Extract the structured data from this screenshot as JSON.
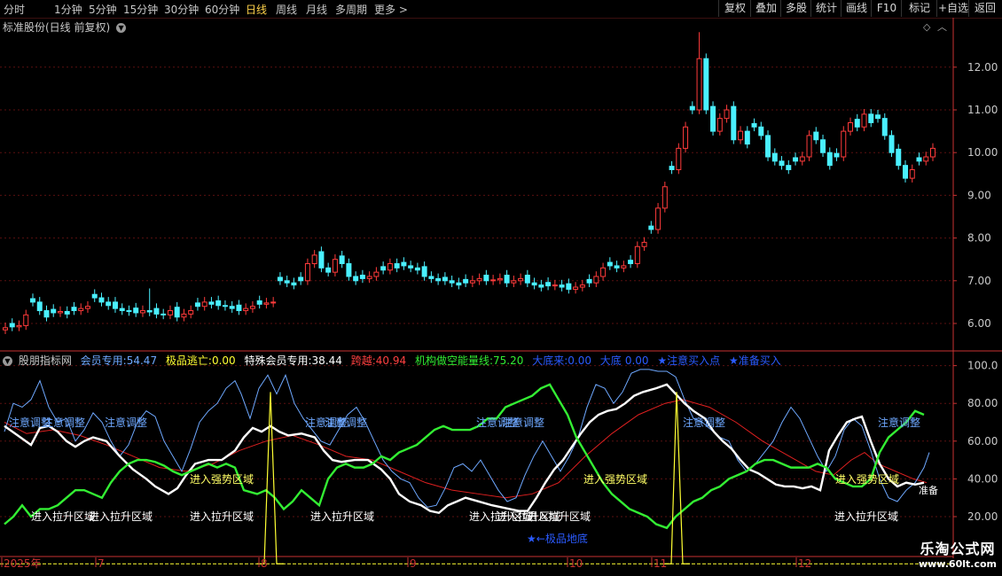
{
  "toolbar": {
    "periods": [
      {
        "label": "分时",
        "active": false
      },
      {
        "label": "1分钟",
        "active": false
      },
      {
        "label": "5分钟",
        "active": false
      },
      {
        "label": "15分钟",
        "active": false
      },
      {
        "label": "30分钟",
        "active": false
      },
      {
        "label": "60分钟",
        "active": false
      },
      {
        "label": "日线",
        "active": true
      },
      {
        "label": "周线",
        "active": false
      },
      {
        "label": "月线",
        "active": false
      },
      {
        "label": "多周期",
        "active": false
      },
      {
        "label": "更多 >",
        "active": false
      }
    ],
    "right_buttons": [
      "复权",
      "叠加",
      "多股",
      "统计",
      "画线",
      "F10",
      "标记",
      "+自选",
      "返回"
    ]
  },
  "main_chart": {
    "title": "标准股份(日线 前复权)",
    "price_labels": [
      "12.00",
      "11.00",
      "10.00",
      "9.00",
      "8.00",
      "7.00",
      "6.00"
    ],
    "colors": {
      "up": "#ff3b3b",
      "down": "#4af0ff",
      "grid": "#5a1010",
      "axis": "#c83232"
    }
  },
  "indicator": {
    "name": "股朋指标网",
    "values": [
      {
        "label": "会员专用:",
        "value": "54.47",
        "color": "#6ea8ff"
      },
      {
        "label": "极品逃亡:",
        "value": "0.00",
        "color": "#ffff33"
      },
      {
        "label": "特殊会员专用:",
        "value": "38.44",
        "color": "#ffffff"
      },
      {
        "label": "跨越:",
        "value": "40.94",
        "color": "#ff4040"
      },
      {
        "label": "机构做空能量线:",
        "value": "75.20",
        "color": "#33ee33"
      },
      {
        "label": "大底来:",
        "value": "0.00",
        "color": "#2b5bff"
      },
      {
        "label": "大底",
        "value": "0.00",
        "color": "#2b5bff"
      },
      {
        "label": "★注意买入点",
        "value": "",
        "color": "#2b5bff"
      },
      {
        "label": "★准备买入",
        "value": "",
        "color": "#2b5bff"
      }
    ],
    "axis_labels": [
      "100.0",
      "80.00",
      "60.00",
      "40.00",
      "20.00"
    ],
    "annotations": {
      "adjust": "注意调整",
      "strong": "进入强势区域",
      "lift": "进入拉升区域",
      "best_bottom": "★←极品地底",
      "ready": "准备"
    }
  },
  "date_axis": {
    "labels": [
      "2025年",
      "7",
      "8",
      "9",
      "10",
      "11",
      "12"
    ]
  },
  "watermark": {
    "line1": "乐淘公式网",
    "line2": "www.60lt.com"
  }
}
